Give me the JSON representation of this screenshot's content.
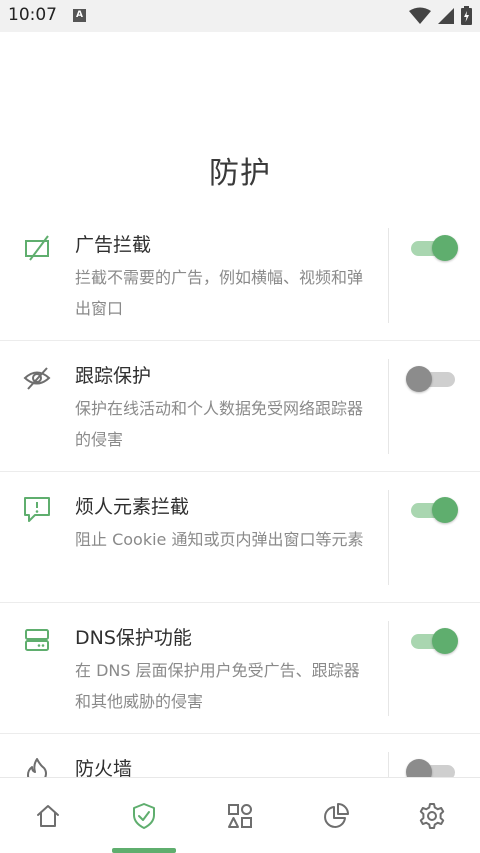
{
  "status_bar": {
    "time": "10:07",
    "notification_badge": "A",
    "icons": [
      "wifi-icon",
      "signal-icon",
      "battery-icon"
    ]
  },
  "page": {
    "title": "防护"
  },
  "features": [
    {
      "icon": "ad-block-icon",
      "title": "广告拦截",
      "description": "拦截不需要的广告，例如横幅、视频和弹出窗口",
      "enabled": true
    },
    {
      "icon": "eye-off-icon",
      "title": "跟踪保护",
      "description": "保护在线活动和个人数据免受网络跟踪器的侵害",
      "enabled": false
    },
    {
      "icon": "alert-message-icon",
      "title": "烦人元素拦截",
      "description": "阻止 Cookie 通知或页内弹出窗口等元素",
      "enabled": true
    },
    {
      "icon": "dns-server-icon",
      "title": "DNS保护功能",
      "description": "在 DNS 层面保护用户免受广告、跟踪器和其他威胁的侵害",
      "enabled": true
    },
    {
      "icon": "fire-icon",
      "title": "防火墙",
      "description": "",
      "enabled": false
    }
  ],
  "bottom_nav": {
    "items": [
      "home-icon",
      "shield-check-icon",
      "apps-icon",
      "stats-pie-icon",
      "settings-gear-icon"
    ],
    "active_index": 1
  },
  "colors": {
    "accent": "#5fae6e",
    "accent_track": "#a9d6b0",
    "off_knob": "#8c8c8c",
    "off_track": "#cfcfcf",
    "icon_gray": "#6e6e6e"
  }
}
